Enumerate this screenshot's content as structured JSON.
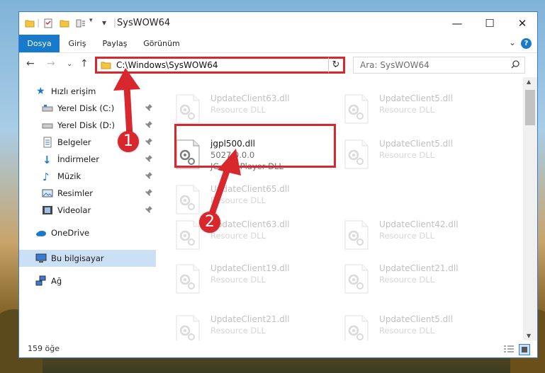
{
  "window": {
    "title": "SysWOW64"
  },
  "ribbon": {
    "tabs": [
      "Dosya",
      "Giriş",
      "Paylaş",
      "Görünüm"
    ],
    "help": "?"
  },
  "address": {
    "path": "C:\\Windows\\SysWOW64"
  },
  "search": {
    "placeholder": "Ara: SysWOW64"
  },
  "sidebar": {
    "items": [
      {
        "label": "Hızlı erişim",
        "icon": "star-icon",
        "pinned": false
      },
      {
        "label": "Yerel Disk (C:)",
        "icon": "disk-icon",
        "pinned": true
      },
      {
        "label": "Yerel Disk (D:)",
        "icon": "disk-icon",
        "pinned": true
      },
      {
        "label": "Belgeler",
        "icon": "documents-icon",
        "pinned": true
      },
      {
        "label": "İndirmeler",
        "icon": "download-icon",
        "pinned": true
      },
      {
        "label": "Müzik",
        "icon": "music-icon",
        "pinned": true
      },
      {
        "label": "Resimler",
        "icon": "pictures-icon",
        "pinned": true
      },
      {
        "label": "Videolar",
        "icon": "videos-icon",
        "pinned": true
      },
      {
        "label": "OneDrive",
        "icon": "onedrive-icon",
        "pinned": false
      },
      {
        "label": "Bu bilgisayar",
        "icon": "computer-icon",
        "pinned": false
      },
      {
        "label": "Ağ",
        "icon": "network-icon",
        "pinned": false
      }
    ]
  },
  "files": [
    {
      "name": "UpdateClient63.dll",
      "type": "Resource DLL",
      "faded": true
    },
    {
      "name": "UpdateClient5.dll",
      "type": "Resource DLL",
      "faded": true
    },
    {
      "name": "jgpl500.dll",
      "version": "5027.0.0.0",
      "type": "JG ART Player DLL",
      "faded": false
    },
    {
      "name": "UpdateClient5.dll",
      "type": "Resource DLL",
      "faded": true
    },
    {
      "name": "UpdateClient65.dll",
      "type": "Resource DLL",
      "faded": true
    },
    {
      "name": "UpdateClient63.dll",
      "type": "Resource DLL",
      "faded": true
    },
    {
      "name": "UpdateClient42.dll",
      "type": "Resource DLL",
      "faded": true
    },
    {
      "name": "UpdateClient19.dll",
      "type": "Resource DLL",
      "faded": true
    },
    {
      "name": "UpdateClient21.dll",
      "type": "Resource DLL",
      "faded": true
    },
    {
      "name": "UpdateClient21.dll",
      "type": "Resource DLL",
      "faded": true
    },
    {
      "name": "UpdateClient5.dll",
      "type": "Resource DLL",
      "faded": true
    }
  ],
  "status": {
    "count": "159 öğe"
  },
  "annotations": {
    "step1": "1",
    "step2": "2"
  },
  "colors": {
    "accent": "#1979ca",
    "highlight": "#d9272e"
  }
}
